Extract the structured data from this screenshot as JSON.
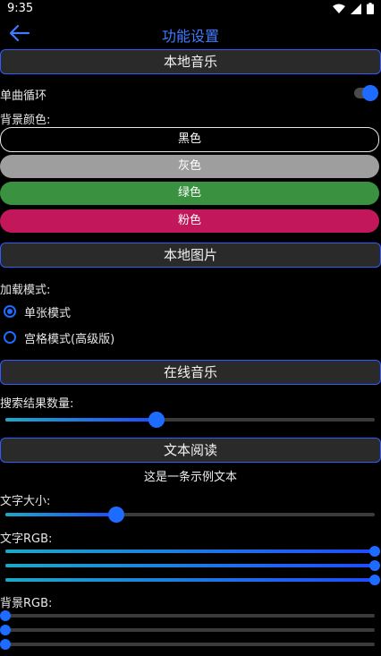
{
  "status": {
    "time": "9:35"
  },
  "app": {
    "title": "功能设置"
  },
  "sections": {
    "local_music": "本地音乐",
    "local_images": "本地图片",
    "online_music": "在线音乐",
    "text_reading": "文本阅读"
  },
  "local_music": {
    "repeat_label": "单曲循环",
    "repeat_on": true,
    "bg_color_label": "背景颜色:",
    "colors": [
      {
        "label": "黑色",
        "color": "#000000"
      },
      {
        "label": "灰色",
        "color": "#9e9e9e"
      },
      {
        "label": "绿色",
        "color": "#3a9240"
      },
      {
        "label": "粉色",
        "color": "#c2185b"
      }
    ]
  },
  "local_images": {
    "mode_label": "加载模式:",
    "options": [
      {
        "label": "单张模式",
        "checked": true
      },
      {
        "label": "宫格模式(高级版)",
        "checked": false
      }
    ]
  },
  "online_music": {
    "count_label": "搜索结果数量:",
    "count_fraction": 0.41
  },
  "text_reading": {
    "sample_text": "这是一条示例文本",
    "font_size_label": "文字大小:",
    "font_size_fraction": 0.3,
    "text_rgb_label": "文字RGB:",
    "text_rgb": [
      1.0,
      1.0,
      1.0
    ],
    "bg_rgb_label": "背景RGB:",
    "bg_rgb": [
      0.0,
      0.0,
      0.0
    ]
  },
  "colors": {
    "accent": "#1e6bff",
    "title": "#3f7bff",
    "header_bg": "#2a2a2a"
  }
}
